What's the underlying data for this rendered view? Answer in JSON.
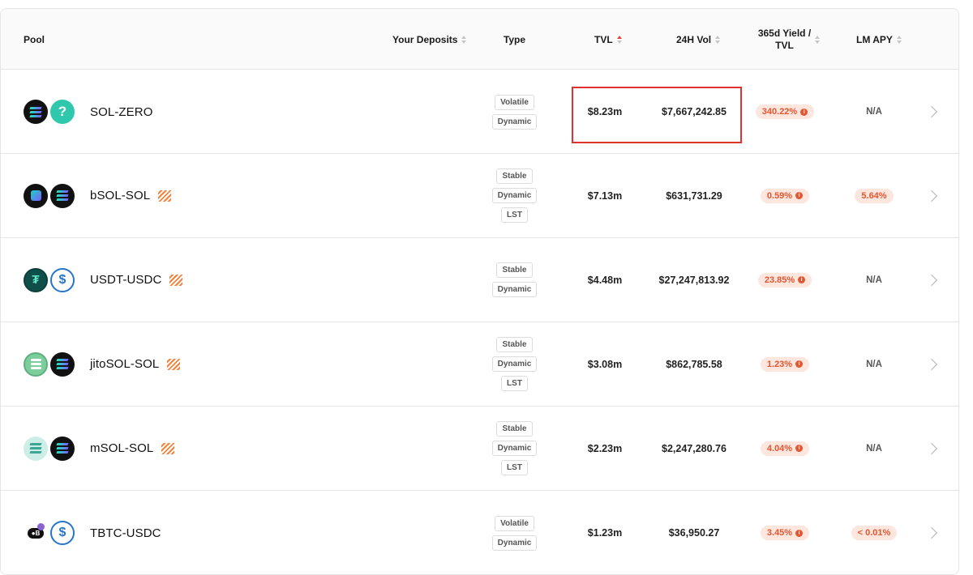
{
  "header": {
    "pool": "Pool",
    "your_deposits": "Your Deposits",
    "type": "Type",
    "tvl": "TVL",
    "vol_24h": "24H Vol",
    "yield_line1": "365d Yield /",
    "yield_line2": "TVL",
    "lm_apy": "LM APY"
  },
  "rows": [
    {
      "name": "SOL-ZERO",
      "tokens": [
        "solana-icon",
        "unknown-token-icon"
      ],
      "tags": [
        "Volatile",
        "Dynamic"
      ],
      "tvl": "$8.23m",
      "vol": "$7,667,242.85",
      "yield": "340.22%",
      "lm_apy": "N/A",
      "lm_highlight": false,
      "farm": false
    },
    {
      "name": "bSOL-SOL",
      "tokens": [
        "bsol-icon",
        "solana-icon"
      ],
      "tags": [
        "Stable",
        "Dynamic",
        "LST"
      ],
      "tvl": "$7.13m",
      "vol": "$631,731.29",
      "yield": "0.59%",
      "lm_apy": "5.64%",
      "lm_highlight": true,
      "farm": true
    },
    {
      "name": "USDT-USDC",
      "tokens": [
        "usdt-icon",
        "usdc-icon"
      ],
      "tags": [
        "Stable",
        "Dynamic"
      ],
      "tvl": "$4.48m",
      "vol": "$27,247,813.92",
      "yield": "23.85%",
      "lm_apy": "N/A",
      "lm_highlight": false,
      "farm": true
    },
    {
      "name": "jitoSOL-SOL",
      "tokens": [
        "jitosol-icon",
        "solana-icon"
      ],
      "tags": [
        "Stable",
        "Dynamic",
        "LST"
      ],
      "tvl": "$3.08m",
      "vol": "$862,785.58",
      "yield": "1.23%",
      "lm_apy": "N/A",
      "lm_highlight": false,
      "farm": true
    },
    {
      "name": "mSOL-SOL",
      "tokens": [
        "msol-icon",
        "solana-icon"
      ],
      "tags": [
        "Stable",
        "Dynamic",
        "LST"
      ],
      "tvl": "$2.23m",
      "vol": "$2,247,280.76",
      "yield": "4.04%",
      "lm_apy": "N/A",
      "lm_highlight": false,
      "farm": true
    },
    {
      "name": "TBTC-USDC",
      "tokens": [
        "tbtc-icon",
        "usdc-icon"
      ],
      "tags": [
        "Volatile",
        "Dynamic"
      ],
      "tvl": "$1.23m",
      "vol": "$36,950.27",
      "yield": "3.45%",
      "lm_apy": "< 0.01%",
      "lm_highlight": true,
      "farm": false
    }
  ],
  "colors": {
    "accent": "#e4562f",
    "highlight_box": "#e0332f",
    "sort_active": "#e0453b"
  }
}
